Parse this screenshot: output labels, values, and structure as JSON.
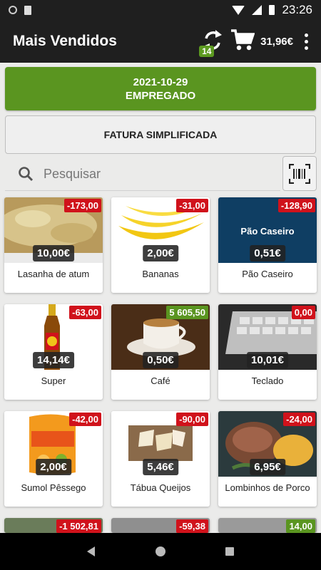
{
  "status_bar": {
    "time": "23:26"
  },
  "app_bar": {
    "title": "Mais Vendidos",
    "sync_badge": "14",
    "cart_total": "31,96€"
  },
  "date_button": {
    "date": "2021-10-29",
    "role": "EMPREGADO"
  },
  "invoice_button": {
    "label": "FATURA SIMPLIFICADA"
  },
  "search": {
    "placeholder": "Pesquisar"
  },
  "products": [
    {
      "name": "Lasanha de atum",
      "price": "10,00€",
      "stock": "-173,00",
      "stock_type": "neg"
    },
    {
      "name": "Bananas",
      "price": "2,00€",
      "stock": "-31,00",
      "stock_type": "neg"
    },
    {
      "name": "Pão Caseiro",
      "price": "0,51€",
      "stock": "-128,90",
      "stock_type": "neg",
      "image_label": "Pão Caseiro"
    },
    {
      "name": "Super",
      "price": "14,14€",
      "stock": "-63,00",
      "stock_type": "neg"
    },
    {
      "name": "Café",
      "price": "0,50€",
      "stock": "5 605,50",
      "stock_type": "pos"
    },
    {
      "name": "Teclado",
      "price": "10,01€",
      "stock": "0,00",
      "stock_type": "neg"
    },
    {
      "name": "Sumol Pêssego",
      "price": "2,00€",
      "stock": "-42,00",
      "stock_type": "neg"
    },
    {
      "name": "Tábua Queijos",
      "price": "5,46€",
      "stock": "-90,00",
      "stock_type": "neg"
    },
    {
      "name": "Lombinhos de Porco",
      "price": "6,95€",
      "stock": "-24,00",
      "stock_type": "neg"
    },
    {
      "stock": "-1 502,81",
      "stock_type": "neg"
    },
    {
      "stock": "-59,38",
      "stock_type": "neg"
    },
    {
      "stock": "14,00",
      "stock_type": "pos"
    }
  ]
}
